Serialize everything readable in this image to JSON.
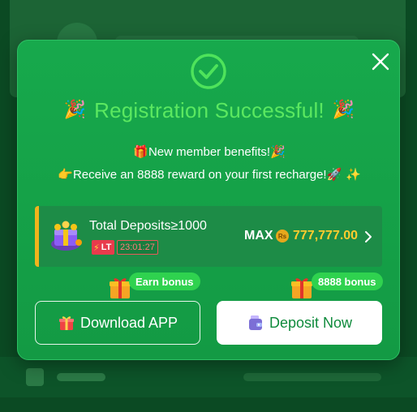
{
  "background": {
    "accent": "#0b4a23"
  },
  "modal": {
    "title": "Registration Successful!",
    "title_emoji_left": "🎉",
    "title_emoji_right": "🎉",
    "benefit_line_1": "New member benefits!",
    "benefit_line_1_emoji_left": "🎁",
    "benefit_line_1_emoji_right": "🎉",
    "benefit_line_2": "Receive an 8888 reward on your first recharge!",
    "benefit_line_2_emoji_left": "👉",
    "benefit_line_2_emoji_right": "🚀 ✨",
    "icons": [
      "check-circle-icon",
      "close-icon"
    ]
  },
  "offer": {
    "title": "Total Deposits≥1000",
    "badge": "LT",
    "countdown": "23:01:27",
    "max_label": "MAX",
    "coin_symbol": "Rs",
    "amount": "777,777.00"
  },
  "tags": {
    "earn": "Earn bonus",
    "bonus": "8888 bonus"
  },
  "buttons": {
    "download": "Download APP",
    "deposit": "Deposit Now"
  },
  "colors": {
    "modal_bg": "#17a94c",
    "title_green": "#5be860",
    "amount_gold": "#ffcc2e",
    "badge_red": "#e83b4c",
    "tag_green": "#2fd24f",
    "deposit_text": "#0f8b3c"
  }
}
